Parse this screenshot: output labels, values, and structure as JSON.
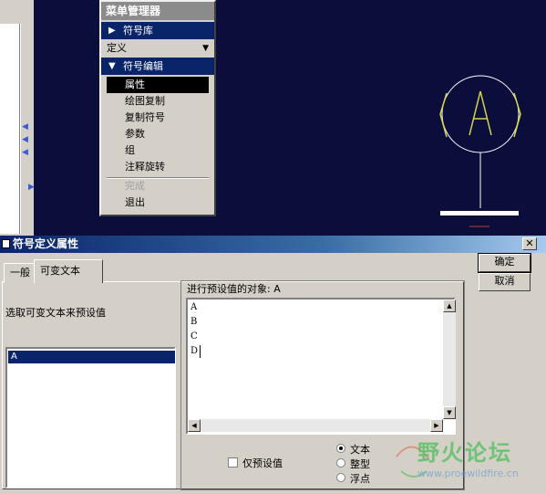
{
  "menu": {
    "title": "菜单管理器",
    "symbol_library": "符号库",
    "define": "定义",
    "symbol_edit": "符号编辑",
    "items": [
      {
        "label": "属性",
        "state": "selected"
      },
      {
        "label": "绘图复制",
        "state": "normal"
      },
      {
        "label": "复制符号",
        "state": "normal"
      },
      {
        "label": "参数",
        "state": "normal"
      },
      {
        "label": "组",
        "state": "normal"
      },
      {
        "label": "注释旋转",
        "state": "normal"
      },
      {
        "label": "完成",
        "state": "disabled"
      },
      {
        "label": "退出",
        "state": "normal"
      }
    ]
  },
  "canvas": {
    "symbol_text": "(A)",
    "symbol_color": "#d7d34a",
    "stem_color": "#ffffff",
    "base_color": "#ffffff",
    "accent_red": "#c83a2a"
  },
  "dialog": {
    "title": "符号定义属性",
    "close_icon": "close-icon",
    "tabs": [
      "一般",
      "可变文本"
    ],
    "active_tab": "可变文本",
    "ok": "确定",
    "cancel": "取消",
    "select_label": "选取可变文本来预设值",
    "left_list": [
      "A"
    ],
    "target_label": "进行预设值的对象: A",
    "target_lines": [
      "A",
      "B",
      "C",
      "D"
    ],
    "preset_only": "仅预设值",
    "radio_options": [
      {
        "label": "文本",
        "checked": true
      },
      {
        "label": "整型",
        "checked": false
      },
      {
        "label": "浮点",
        "checked": false
      }
    ]
  },
  "watermark": {
    "title": "野火论坛",
    "url": "www.proewildfire.cn",
    "color": "#5fc06a"
  }
}
